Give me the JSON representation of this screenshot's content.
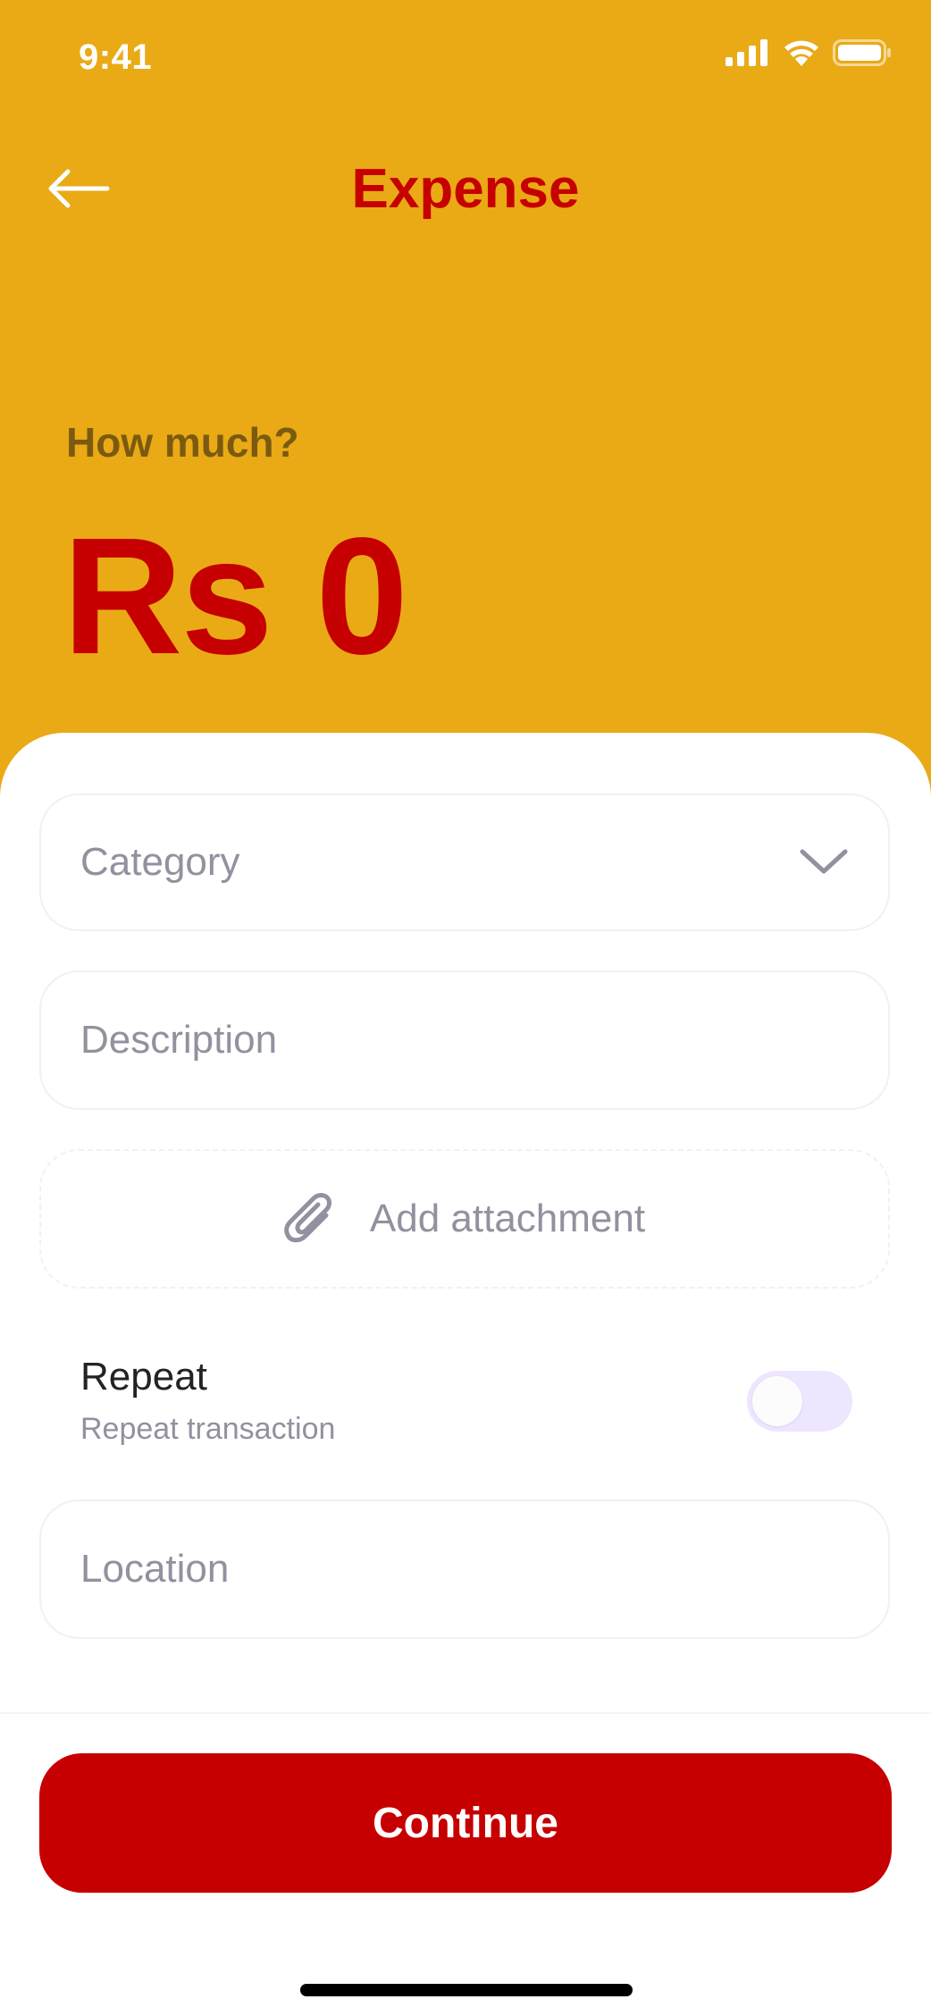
{
  "status_bar": {
    "time": "9:41",
    "icons": [
      "cellular-signal-icon",
      "wifi-icon",
      "battery-icon"
    ]
  },
  "header": {
    "back_icon": "arrow-left-icon",
    "title": "Expense"
  },
  "amount": {
    "label": "How much?",
    "currency": "Rs",
    "value": "0"
  },
  "form": {
    "category": {
      "placeholder": "Category",
      "icon": "chevron-down-icon"
    },
    "description": {
      "placeholder": "Description"
    },
    "attachment": {
      "label": "Add attachment",
      "icon": "paperclip-icon"
    },
    "repeat": {
      "title": "Repeat",
      "subtitle": "Repeat transaction",
      "enabled": false
    },
    "location": {
      "placeholder": "Location"
    }
  },
  "actions": {
    "continue_label": "Continue"
  },
  "colors": {
    "background": "#E9AA16",
    "accent_red": "#C60000",
    "label_brown": "#7B5A10",
    "placeholder_gray": "#91919F",
    "toggle_track": "#EEE5FF"
  }
}
